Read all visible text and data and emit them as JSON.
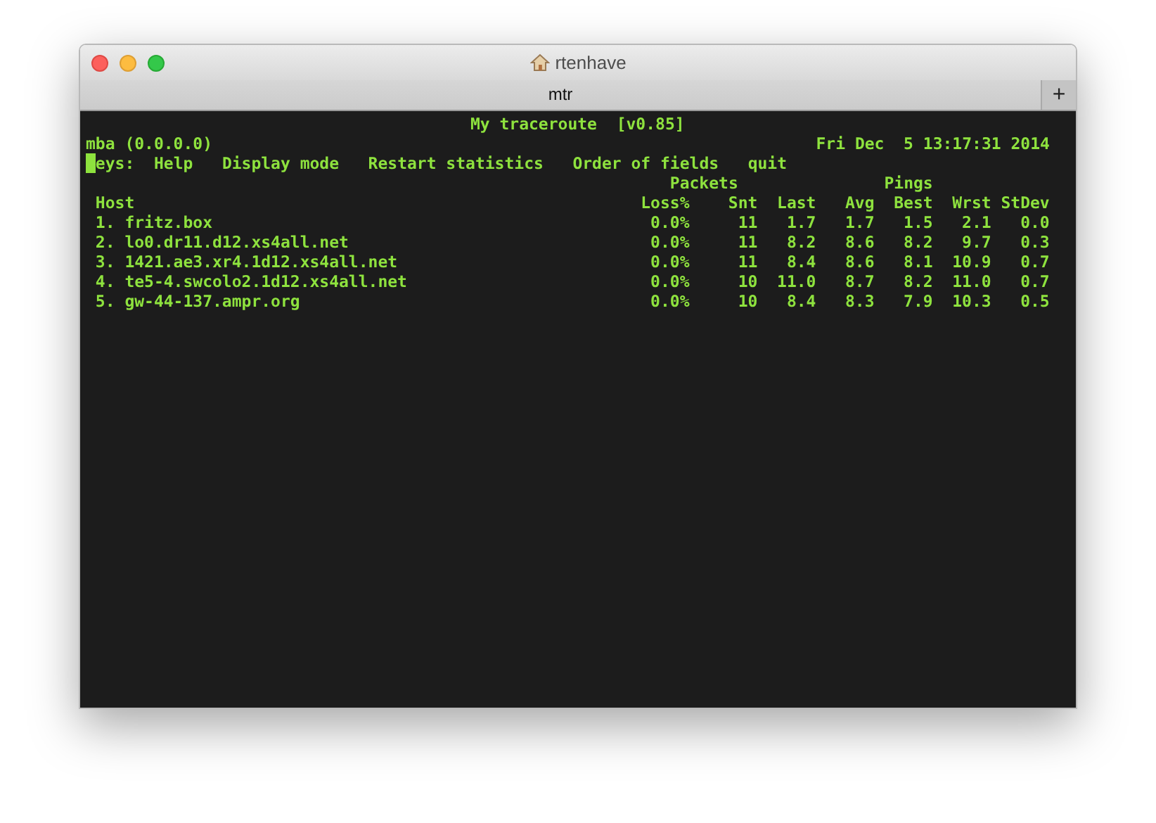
{
  "window": {
    "title": "rtenhave"
  },
  "tabs": [
    {
      "label": "mtr",
      "selected": true
    }
  ],
  "new_tab_button": "+",
  "terminal": {
    "title": "My traceroute  [v0.85]",
    "host": "mba (0.0.0.0)",
    "datetime": "Fri Dec  5 13:17:31 2014",
    "keys_label": "eys:",
    "cursor": true,
    "keys": [
      "Help",
      "Display mode",
      "Restart statistics",
      "Order of fields",
      "quit"
    ],
    "group_headers": [
      "Packets",
      "Pings"
    ],
    "columns": [
      "Host",
      "Loss%",
      "Snt",
      "Last",
      "Avg",
      "Best",
      "Wrst",
      "StDev"
    ],
    "rows": [
      [
        "1. fritz.box",
        "0.0%",
        "11",
        "1.7",
        "1.7",
        "1.5",
        "2.1",
        "0.0"
      ],
      [
        "2. lo0.dr11.d12.xs4all.net",
        "0.0%",
        "11",
        "8.2",
        "8.6",
        "8.2",
        "9.7",
        "0.3"
      ],
      [
        "3. 1421.ae3.xr4.1d12.xs4all.net",
        "0.0%",
        "11",
        "8.4",
        "8.6",
        "8.1",
        "10.9",
        "0.7"
      ],
      [
        "4. te5-4.swcolo2.1d12.xs4all.net",
        "0.0%",
        "10",
        "11.0",
        "8.7",
        "8.2",
        "11.0",
        "0.7"
      ],
      [
        "5. gw-44-137.ampr.org",
        "0.0%",
        "10",
        "8.4",
        "8.3",
        "7.9",
        "10.3",
        "0.5"
      ]
    ]
  }
}
